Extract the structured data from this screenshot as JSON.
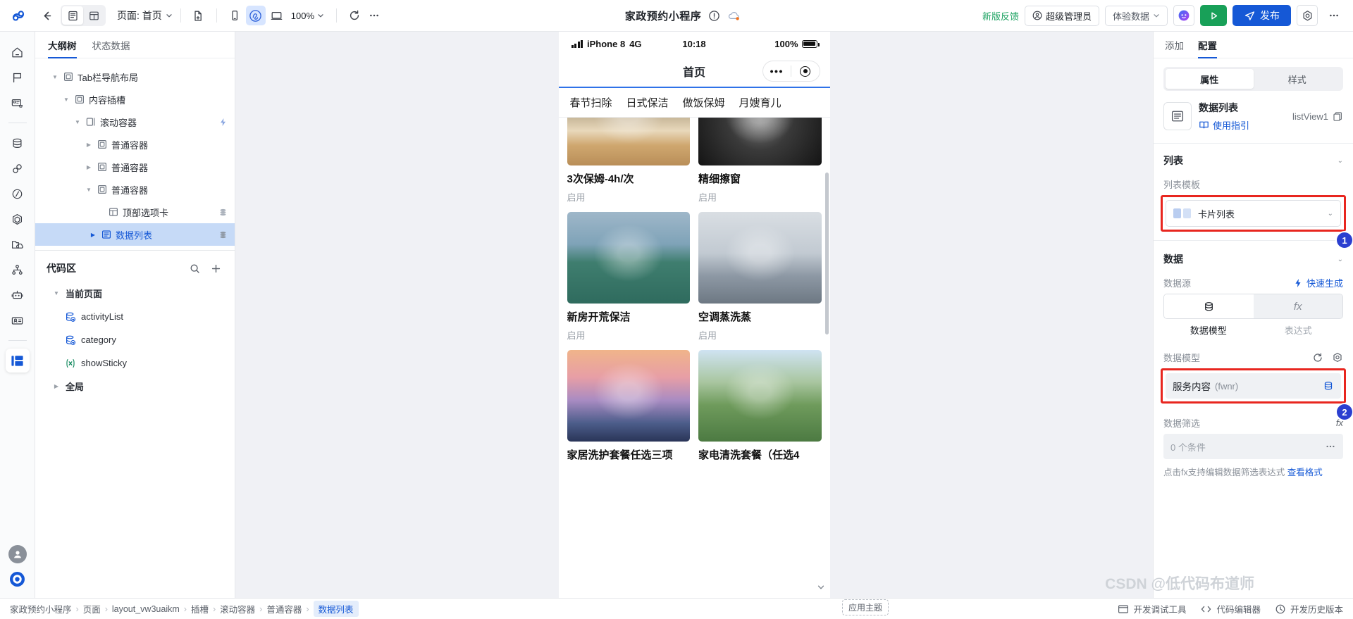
{
  "topbar": {
    "logo": "cloud-logo",
    "back": "back-arrow",
    "view_modes": [
      {
        "id": "outline-view",
        "icon": "list-view-icon",
        "active": true
      },
      {
        "id": "grid-view",
        "icon": "grid-view-icon",
        "active": false
      }
    ],
    "page_label": "页面: 首页",
    "new_page_icon": "new-page-icon",
    "devices": [
      {
        "id": "mobile",
        "icon": "mobile-icon",
        "active": false
      },
      {
        "id": "miniprogram",
        "icon": "miniprogram-icon",
        "active": true
      },
      {
        "id": "desktop",
        "icon": "desktop-icon",
        "active": false
      }
    ],
    "zoom": "100%",
    "refresh_icon": "refresh-icon",
    "more_icon": "more-horizontal-icon",
    "app_title": "家政预约小程序",
    "warn_icon": "exclamation-circle-icon",
    "cloud_icon": "cloud-status-icon",
    "feedback": "新版反馈",
    "role": "超级管理员",
    "env": "体验数据",
    "ai_icon": "ai-assistant-icon",
    "preview_icon": "preview-play-icon",
    "publish": "发布",
    "settings_icon": "gear-icon",
    "overflow_icon": "more-horizontal-icon"
  },
  "rail": {
    "items": [
      {
        "id": "home",
        "icon": "home-icon"
      },
      {
        "id": "flag",
        "icon": "flag-icon"
      },
      {
        "id": "page-store",
        "icon": "page-cart-icon"
      },
      {
        "id": "database",
        "icon": "database-icon"
      },
      {
        "id": "connector",
        "icon": "link-icon"
      },
      {
        "id": "workflow",
        "icon": "slash-hexagon-icon"
      },
      {
        "id": "component",
        "icon": "hexagon-icon"
      },
      {
        "id": "assets",
        "icon": "folder-cloud-icon"
      },
      {
        "id": "sitemap",
        "icon": "sitemap-icon"
      },
      {
        "id": "robot",
        "icon": "robot-icon"
      },
      {
        "id": "members",
        "icon": "id-card-icon"
      },
      {
        "id": "editor",
        "icon": "layout-panel-icon",
        "selected": true
      }
    ],
    "bottom": [
      {
        "id": "account",
        "icon": "user-avatar-icon"
      },
      {
        "id": "help",
        "icon": "help-circle-icon"
      }
    ]
  },
  "tree_panel": {
    "tabs": [
      {
        "label": "大纲树",
        "active": true
      },
      {
        "label": "状态数据",
        "active": false
      }
    ],
    "nodes": [
      {
        "label": "Tab栏导航布局",
        "depth": 0,
        "icon": "container-icon",
        "caret": "down",
        "badge": ""
      },
      {
        "label": "内容插槽",
        "depth": 1,
        "icon": "container-icon",
        "caret": "down",
        "badge": ""
      },
      {
        "label": "滚动容器",
        "depth": 2,
        "icon": "scroll-container-icon",
        "caret": "down",
        "badge": "bolt"
      },
      {
        "label": "普通容器",
        "depth": 3,
        "icon": "container-icon",
        "caret": "right",
        "badge": ""
      },
      {
        "label": "普通容器",
        "depth": 3,
        "icon": "container-icon",
        "caret": "right",
        "badge": ""
      },
      {
        "label": "普通容器",
        "depth": 3,
        "icon": "container-icon",
        "caret": "down",
        "badge": ""
      },
      {
        "label": "顶部选项卡",
        "depth": 4,
        "icon": "tabs-icon",
        "caret": "none",
        "badge": "data"
      },
      {
        "label": "数据列表",
        "depth": 4,
        "icon": "list-icon",
        "caret": "right",
        "badge": "data",
        "selected": true
      }
    ],
    "code_area": {
      "title": "代码区",
      "search_icon": "search-icon",
      "add_icon": "plus-icon",
      "groups": [
        {
          "label": "当前页面",
          "caret": "down",
          "type": "group"
        },
        {
          "label": "activityList",
          "icon": "datasource-icon",
          "type": "item"
        },
        {
          "label": "category",
          "icon": "datasource-icon",
          "type": "item"
        },
        {
          "label": "showSticky",
          "icon": "variable-icon",
          "type": "item"
        },
        {
          "label": "全局",
          "caret": "right",
          "type": "group"
        }
      ]
    }
  },
  "canvas": {
    "status": {
      "carrier": "iPhone 8",
      "network": "4G",
      "time": "10:18",
      "battery": "100%"
    },
    "nav_title": "首页",
    "tabs": [
      "春节扫除",
      "日式保洁",
      "做饭保姆",
      "月嫂育儿"
    ],
    "cards": [
      {
        "title": "3次保姆-4h/次",
        "status": "启用",
        "img": "img1"
      },
      {
        "title": "精细擦窗",
        "status": "启用",
        "img": "img2"
      },
      {
        "title": "新房开荒保洁",
        "status": "启用",
        "img": "img3"
      },
      {
        "title": "空调蒸洗蒸",
        "status": "启用",
        "img": "img4"
      },
      {
        "title": "家居洗护套餐任选三项",
        "status": "",
        "img": "img5"
      },
      {
        "title": "家电清洗套餐（任选4",
        "status": "",
        "img": "img6"
      }
    ]
  },
  "right_panel": {
    "tabs": [
      {
        "label": "添加",
        "active": false
      },
      {
        "label": "配置",
        "active": true
      }
    ],
    "subtabs": [
      {
        "label": "属性",
        "active": true
      },
      {
        "label": "样式",
        "active": false
      }
    ],
    "component": {
      "icon": "list-icon",
      "name": "数据列表",
      "guide": "使用指引",
      "guide_icon": "book-icon",
      "id": "listView1",
      "copy_icon": "copy-icon"
    },
    "list_section": {
      "title": "列表",
      "template_label": "列表模板",
      "template_value": "卡片列表",
      "template_icon": "card-list-icon"
    },
    "data_section": {
      "title": "数据",
      "source_label": "数据源",
      "quick_gen": "快速生成",
      "quick_gen_icon": "bolt-icon",
      "source_tabs": [
        {
          "label": "数据模型",
          "icon": "database-icon",
          "active": true
        },
        {
          "label": "表达式",
          "icon": "fx-icon",
          "active": false
        }
      ],
      "model_label": "数据模型",
      "refresh_icon": "refresh-icon",
      "settings_icon": "gear-icon",
      "model_name": "服务内容",
      "model_code": "(fwnr)",
      "model_icon": "database-icon",
      "filter_label": "数据筛选",
      "filter_fx": "fx",
      "filter_value": "0 个条件",
      "filter_more_icon": "more-horizontal-icon",
      "hint_prefix": "点击fx支持编辑数据筛选表达式 ",
      "hint_link": "查看格式"
    },
    "badges": [
      {
        "num": "1"
      },
      {
        "num": "2"
      }
    ]
  },
  "bottombar": {
    "breadcrumbs": [
      "家政预约小程序",
      "页面",
      "layout_vw3uaikm",
      "插槽",
      "滚动容器",
      "普通容器",
      "数据列表"
    ],
    "active_index": 6,
    "theme_btn": "应用主题",
    "right_items": [
      {
        "label": "开发调试工具",
        "icon": "devtools-icon"
      },
      {
        "label": "代码编辑器",
        "icon": "code-icon"
      },
      {
        "label": "开发历史版本",
        "icon": "history-icon"
      }
    ]
  },
  "watermark": "CSDN @低代码布道师"
}
